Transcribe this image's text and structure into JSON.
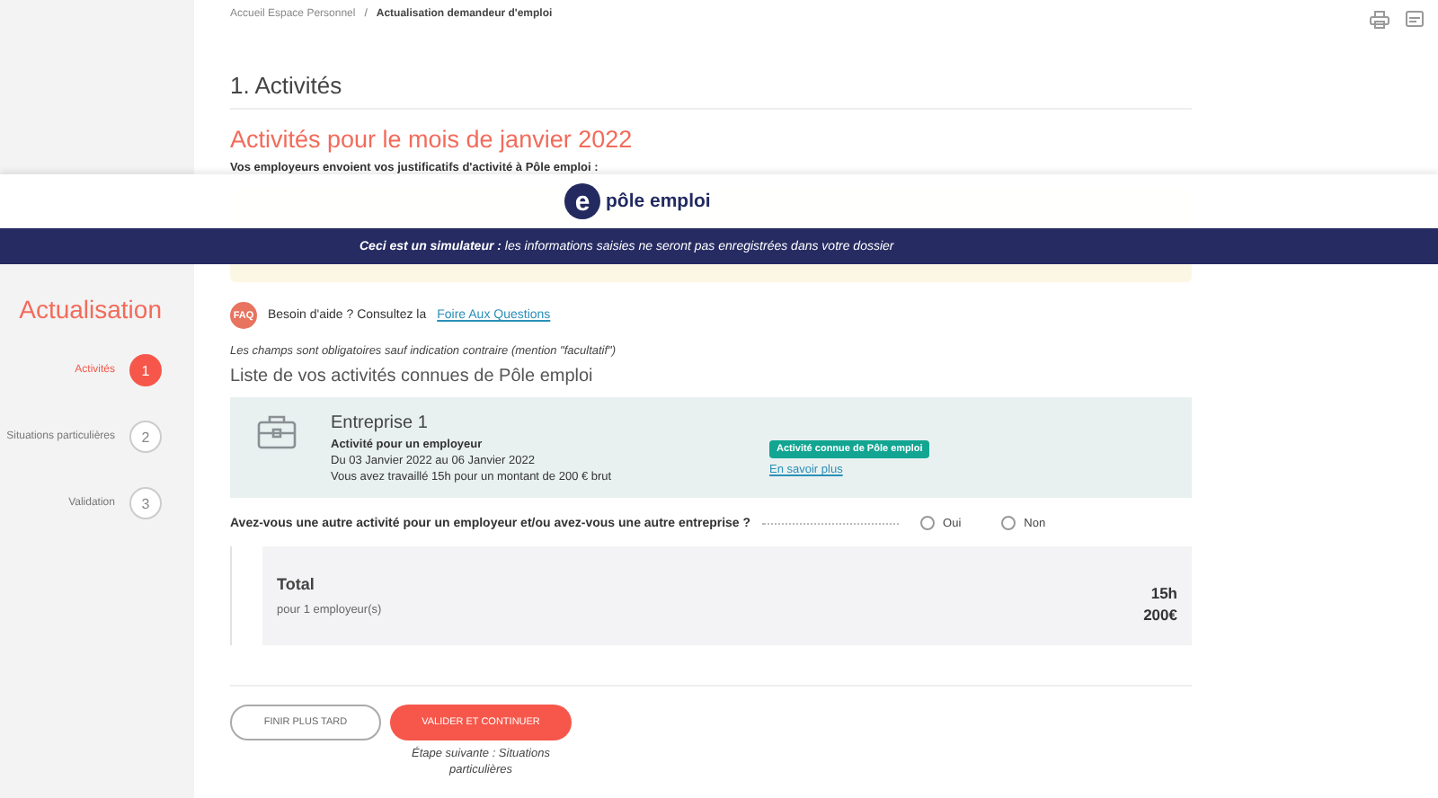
{
  "breadcrumb": {
    "separator": "/",
    "items": [
      {
        "label": "Accueil Espace Personnel",
        "current": false
      },
      {
        "label": "Actualisation demandeur d'emploi",
        "current": true
      }
    ]
  },
  "page_title": "1. Activités",
  "month_title": "Activités pour le mois de janvier 2022",
  "intro": "Vos employeurs envoient vos justificatifs d'activité à Pôle emploi :",
  "simulator_banner": {
    "logo_mark": "e",
    "logo_text": "pôle emploi",
    "message": "**Ceci est un simulateur :** les informations saisies ne seront pas enregistrées dans votre dossier"
  },
  "sidebar": {
    "title": "Actualisation",
    "steps": [
      {
        "number": "1",
        "label": "Activités",
        "selected": true
      },
      {
        "number": "2",
        "label": "Situations particulières",
        "selected": false
      },
      {
        "number": "3",
        "label": "Validation",
        "selected": false
      }
    ]
  },
  "help": {
    "badge": "FAQ",
    "text": "Besoin d'aide ? Consultez la",
    "link": "Foire Aux Questions"
  },
  "mandatory_note": "Les champs sont obligatoires sauf indication contraire (mention \"facultatif\")",
  "activities": {
    "title": "Liste de vos activités connues de Pôle emploi",
    "cards": [
      {
        "name": "Entreprise 1",
        "type": "Activité pour un employeur",
        "period": "Du 03 Janvier 2022 au 06 Janvier 2022",
        "summary": "Vous avez travaillé 15h pour un montant de 200 € brut",
        "tag": "Activité connue de Pôle emploi",
        "link": "En savoir plus"
      }
    ]
  },
  "question": {
    "label": "Avez-vous une autre activité pour un employeur et/ou avez-vous une autre entreprise ?",
    "options": [
      {
        "label": "Oui",
        "selected": false
      },
      {
        "label": "Non",
        "selected": false
      }
    ]
  },
  "total": {
    "label": "Total",
    "sub": "pour 1 employeur(s)",
    "hours": "15h",
    "amount": "200€"
  },
  "buttons": [
    {
      "label": "FINIR PLUS TARD",
      "kind": "secondary"
    },
    {
      "label": "VALIDER ET CONTINUER",
      "kind": "primary"
    }
  ],
  "next_step": "Étape suivante : Situations particulières"
}
